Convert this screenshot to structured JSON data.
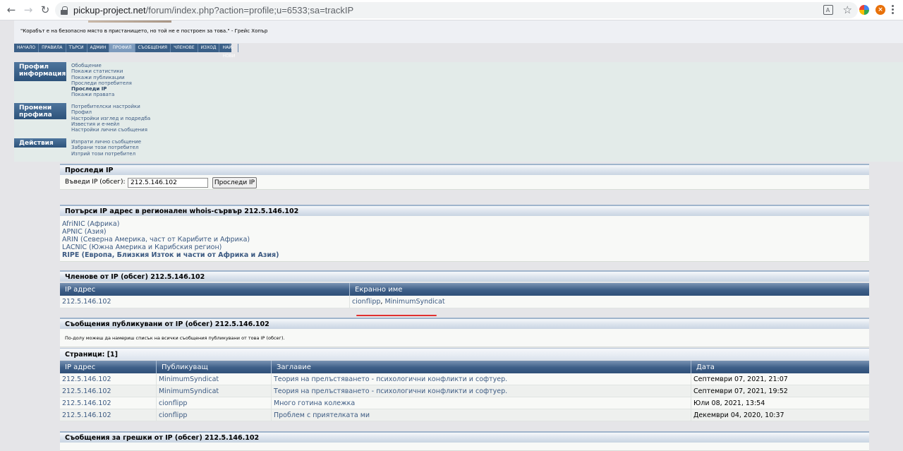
{
  "browser": {
    "url_host": "pickup-project.net",
    "url_path": "/forum/index.php?action=profile;u=6533;sa=trackIP"
  },
  "header": {
    "quote": "\"Корабът е на безопасно място в пристанището, но той не е построен за това.\" - Грейс Хопър"
  },
  "topnav": [
    "НАЧАЛО",
    "ПРАВИЛА",
    "ТЪРСИ",
    "АДМИН",
    "ПРОФИЛ",
    "СЪОБЩЕНИЯ",
    "ЧЛЕНОВЕ",
    "ИЗХОД",
    "НАЙ-НОВИ"
  ],
  "profile_menu": {
    "info": {
      "title_line1": "Профил",
      "title_line2": "информация",
      "links": [
        "Обобщение",
        "Покажи статистики",
        "Покажи публикации",
        "Проследи потребителя",
        "Проследи IP",
        "Покажи правата"
      ]
    },
    "modify": {
      "title_line1": "Промени",
      "title_line2": "профила",
      "links": [
        "Потребителски настройки",
        "Профил",
        "Настройки изглед и подредба",
        "Известия и е-мейл",
        "Настройки лични съобщения"
      ]
    },
    "actions": {
      "title": "Действия",
      "links": [
        "Изпрати лично съобщение",
        "Забрани този потребител",
        "Изтрий този потребител"
      ]
    }
  },
  "track_ip": {
    "title": "Проследи IP",
    "label": "Въведи IP (обсег):",
    "value": "212.5.146.102",
    "button": "Проследи IP"
  },
  "whois": {
    "title": "Потърси IP адрес в регионален whois-сървър 212.5.146.102",
    "links": [
      "AfriNIC (Африка)",
      "APNIC (Азия)",
      "ARIN (Северна Америка, част от Карибите и Африка)",
      "LACNIC (Южна Америка и Карибския регион)",
      "RIPE (Европа, Близкия Изток и части от Африка и Азия)"
    ]
  },
  "members": {
    "title": "Членове от IP (обсег) 212.5.146.102",
    "col_ip": "IP адрес",
    "col_name": "Екранно име",
    "row_ip": "212.5.146.102",
    "name1": "cionflipp",
    "name2": "MinimumSyndicat"
  },
  "posts": {
    "title": "Съобщения публикувани от IP (обсег) 212.5.146.102",
    "note": "По-долу можеш да намериш списък на всички съобщения публикувани от това IP (обсег).",
    "pages": "Страници: [1]",
    "cols": [
      "IP адрес",
      "Публикуващ",
      "Заглавие",
      "Дата"
    ],
    "rows": [
      [
        "212.5.146.102",
        "MinimumSyndicat",
        "Теория на прелъстяването - психологични конфликти и софтуер.",
        "Септември 07, 2021, 21:07"
      ],
      [
        "212.5.146.102",
        "MinimumSyndicat",
        "Теория на прелъстяването - психологични конфликти и софтуер.",
        "Септември 07, 2021, 19:52"
      ],
      [
        "212.5.146.102",
        "cionflipp",
        "Много готина колежка",
        "Юли 08, 2021, 13:54"
      ],
      [
        "212.5.146.102",
        "cionflipp",
        "Проблем с приятелката ми",
        "Декември 04, 2020, 10:37"
      ]
    ]
  },
  "errors": {
    "title": "Съобщения за грешки от IP (обсег) 212.5.146.102"
  }
}
